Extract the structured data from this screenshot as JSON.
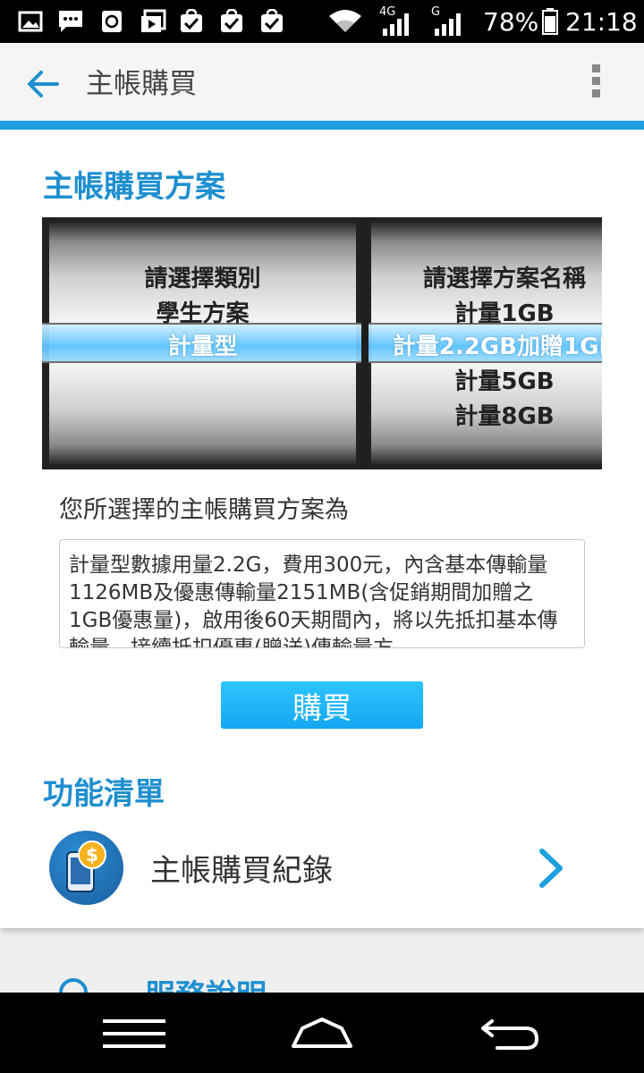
{
  "status_bar": {
    "network_4g": "4G",
    "network_g": "G",
    "battery": "78%",
    "time": "21:18",
    "icons": [
      "image-icon",
      "chat-icon",
      "recycle-icon",
      "video-store-icon",
      "bag-check-icon",
      "bag-check-icon",
      "bag-check-icon",
      "wifi-icon",
      "signal-icon",
      "signal-icon",
      "battery-icon"
    ]
  },
  "app_bar": {
    "title": "主帳購買",
    "back_icon": "back-arrow-icon",
    "menu_icon": "overflow-menu-icon"
  },
  "plan_section": {
    "title": "主帳購買方案",
    "picker": {
      "category_items": [
        "請選擇類別",
        "學生方案",
        "計量型",
        ""
      ],
      "category_selected": "計量型",
      "plan_items": [
        "請選擇方案名稱",
        "計量1GB",
        "計量2.2GB加贈1GB",
        "計量5GB",
        "計量8GB"
      ],
      "plan_selected": "計量2.2GB加贈1GB"
    },
    "selected_label": "您所選擇的主帳購買方案為",
    "description": "計量型數據用量2.2G，費用300元，內含基本傳輸量1126MB及優惠傳輸量2151MB(含促銷期間加贈之1GB優惠量)，啟用後60天期間內，將以先抵扣基本傳輸量，接續抵扣優惠(贈送)傳輸量方",
    "buy_button": "購買"
  },
  "function_section": {
    "title": "功能清單",
    "items": [
      {
        "label": "主帳購買紀錄",
        "icon": "purchase-record-icon"
      }
    ]
  },
  "next_section": {
    "title": "服務說明"
  },
  "colors": {
    "accent": "#1e9fe0",
    "title_blue": "#1e8fd0",
    "button": "#14a8f2"
  }
}
